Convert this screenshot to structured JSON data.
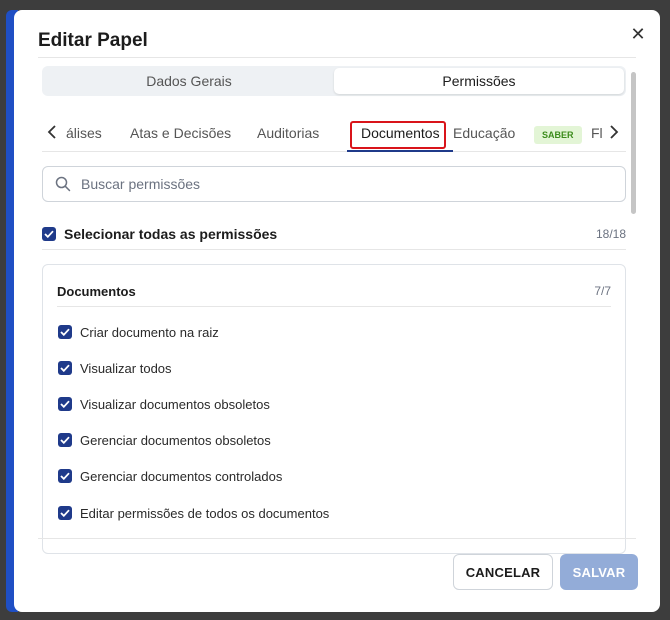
{
  "dialog": {
    "title": "Editar Papel",
    "close_symbol": "✕"
  },
  "segments": [
    {
      "label": "Dados Gerais",
      "active": false
    },
    {
      "label": "Permissões",
      "active": true
    }
  ],
  "tabs": {
    "items": [
      {
        "label": "álises"
      },
      {
        "label": "Atas e Decisões"
      },
      {
        "label": "Auditorias"
      },
      {
        "label": "Documentos",
        "active": true
      },
      {
        "label": "Educação",
        "badge": "SABER"
      },
      {
        "label": "Fl"
      }
    ],
    "highlight_color": "#d9141a",
    "underline_color": "#1f3a8a"
  },
  "search": {
    "placeholder": "Buscar permissões",
    "value": ""
  },
  "select_all": {
    "label": "Selecionar todas as permissões",
    "count": "18/18",
    "checked": true
  },
  "group": {
    "title": "Documentos",
    "count": "7/7",
    "items": [
      {
        "label": "Criar documento na raiz",
        "checked": true
      },
      {
        "label": "Visualizar todos",
        "checked": true
      },
      {
        "label": "Visualizar documentos obsoletos",
        "checked": true
      },
      {
        "label": "Gerenciar documentos obsoletos",
        "checked": true
      },
      {
        "label": "Gerenciar documentos controlados",
        "checked": true
      },
      {
        "label": "Editar permissões de todos os documentos",
        "checked": true
      }
    ]
  },
  "footer": {
    "cancel_label": "CANCELAR",
    "save_label": "SALVAR"
  },
  "colors": {
    "accent": "#1f3a8a",
    "badge_bg": "#e3f5d6",
    "badge_text": "#3c8c1c",
    "save_disabled": "#93acd8"
  },
  "icons": {
    "close": "close-icon",
    "tabs_prev": "chevron-left-icon",
    "tabs_next": "chevron-right-icon",
    "search": "search-icon",
    "check": "checkmark-icon"
  }
}
